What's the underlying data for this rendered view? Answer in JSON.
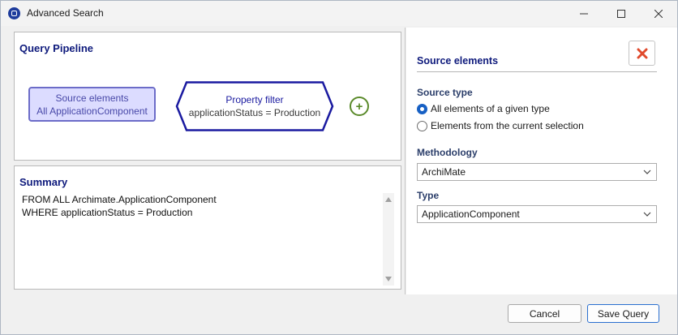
{
  "window": {
    "title": "Advanced Search"
  },
  "pipeline": {
    "title": "Query Pipeline",
    "source_node": {
      "title": "Source elements",
      "subtitle": "All ApplicationComponent"
    },
    "filter_node": {
      "title": "Property filter",
      "subtitle": "applicationStatus = Production"
    },
    "add_icon": "plus-circle-icon"
  },
  "summary": {
    "title": "Summary",
    "lines": [
      "FROM ALL Archimate.ApplicationComponent",
      "WHERE applicationStatus = Production"
    ]
  },
  "source_panel": {
    "title": "Source elements",
    "source_type_label": "Source type",
    "options": [
      {
        "label": "All elements of a given type",
        "selected": true
      },
      {
        "label": "Elements from the current selection",
        "selected": false
      }
    ],
    "methodology_label": "Methodology",
    "methodology_value": "ArchiMate",
    "type_label": "Type",
    "type_value": "ApplicationComponent",
    "remove_icon": "red-x-icon"
  },
  "footer": {
    "cancel": "Cancel",
    "save": "Save Query"
  },
  "colors": {
    "accent": "#0e1a7c",
    "remove": "#e04a2c",
    "add": "#5a8a2a",
    "radio": "#1760c4"
  }
}
